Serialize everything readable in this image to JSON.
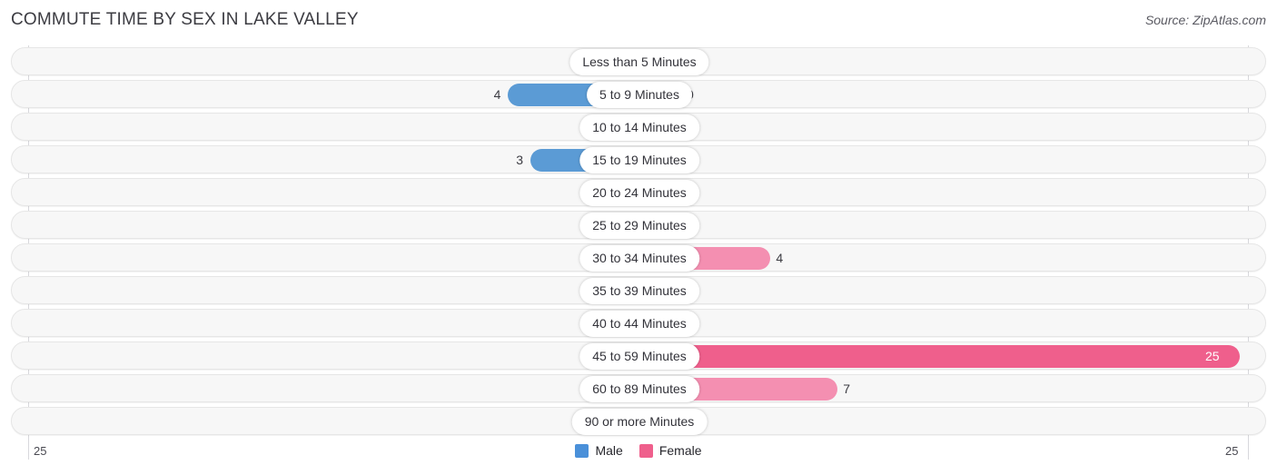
{
  "header": {
    "title": "COMMUTE TIME BY SEX IN LAKE VALLEY",
    "source": "Source: ZipAtlas.com"
  },
  "axis": {
    "left_label": "25",
    "right_label": "25",
    "max": 25
  },
  "legend": [
    {
      "label": "Male",
      "color": "#4a90d9"
    },
    {
      "label": "Female",
      "color": "#ef5f8c"
    }
  ],
  "colors": {
    "male_active": "#5b9bd5",
    "male_zero": "#a8c8ec",
    "female_active": "#ef5f8c",
    "female_mid": "#f48fb1",
    "female_zero": "#f9a8c4",
    "track": "#f7f7f7",
    "track_border": "#e6e6e6",
    "grid": "#d8d8dc"
  },
  "chart_data": {
    "type": "bar",
    "orientation": "horizontal-diverging",
    "title": "COMMUTE TIME BY SEX IN LAKE VALLEY",
    "xlabel": "",
    "ylabel": "",
    "xlim": [
      25,
      25
    ],
    "grid": true,
    "legend_position": "bottom-center",
    "categories": [
      "Less than 5 Minutes",
      "5 to 9 Minutes",
      "10 to 14 Minutes",
      "15 to 19 Minutes",
      "20 to 24 Minutes",
      "25 to 29 Minutes",
      "30 to 34 Minutes",
      "35 to 39 Minutes",
      "40 to 44 Minutes",
      "45 to 59 Minutes",
      "60 to 89 Minutes",
      "90 or more Minutes"
    ],
    "series": [
      {
        "name": "Male",
        "side": "left",
        "values": [
          0,
          4,
          0,
          3,
          0,
          0,
          0,
          0,
          0,
          0,
          0,
          0
        ]
      },
      {
        "name": "Female",
        "side": "right",
        "values": [
          0,
          0,
          0,
          0,
          0,
          0,
          4,
          0,
          0,
          25,
          7,
          0
        ]
      }
    ],
    "value_labels": {
      "male": [
        "0",
        "4",
        "0",
        "3",
        "0",
        "0",
        "0",
        "0",
        "0",
        "0",
        "0",
        "0"
      ],
      "female": [
        "0",
        "0",
        "0",
        "0",
        "0",
        "0",
        "4",
        "0",
        "0",
        "25",
        "7",
        "0"
      ]
    }
  }
}
